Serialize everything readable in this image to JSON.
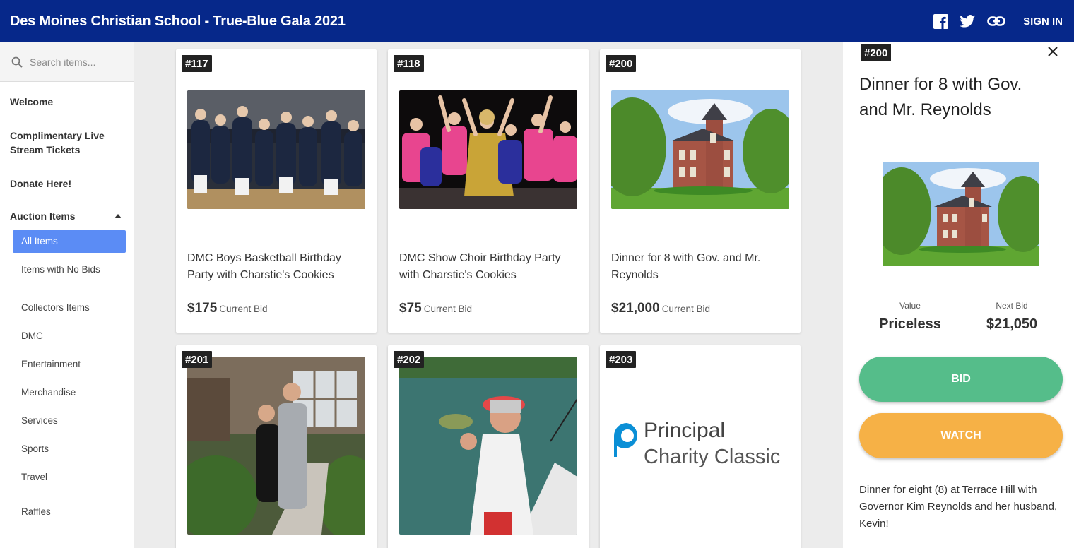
{
  "header": {
    "title": "Des Moines Christian School - True-Blue Gala 2021",
    "sign_in": "SIGN IN",
    "icons": [
      "facebook-icon",
      "twitter-icon",
      "link-icon"
    ],
    "bg_color": "#06288a"
  },
  "sidebar": {
    "search_placeholder": "Search items...",
    "welcome": "Welcome",
    "stream": "Complimentary Live Stream Tickets",
    "donate": "Donate Here!",
    "auction_section": "Auction Items",
    "all_items": "All Items",
    "no_bids": "Items with No Bids",
    "categories": [
      "Collectors Items",
      "DMC",
      "Entertainment",
      "Merchandise",
      "Services",
      "Sports",
      "Travel"
    ],
    "raffles": "Raffles",
    "accent_color": "#5b8cf5"
  },
  "items": [
    {
      "number": "#117",
      "title": "DMC Boys Basketball Birthday Party with Charstie's Cookies",
      "bid": "$175",
      "bid_label": "Current Bid"
    },
    {
      "number": "#118",
      "title": "DMC Show Choir Birthday Party with Charstie's Cookies",
      "bid": "$75",
      "bid_label": "Current Bid"
    },
    {
      "number": "#200",
      "title": "Dinner for 8 with Gov. and Mr. Reynolds",
      "bid": "$21,000",
      "bid_label": "Current Bid"
    },
    {
      "number": "#201"
    },
    {
      "number": "#202"
    },
    {
      "number": "#203",
      "logo_line1": "Principal",
      "logo_line2": "Charity Classic"
    }
  ],
  "detail": {
    "number": "#200",
    "title": "Dinner for 8 with Gov. and Mr. Reynolds",
    "value_label": "Value",
    "value": "Priceless",
    "next_bid_label": "Next Bid",
    "next_bid": "$21,050",
    "bid_button": "BID",
    "watch_button": "WATCH",
    "description": "Dinner for eight (8) at Terrace Hill with Governor Kim Reynolds and her husband, Kevin!",
    "bid_color": "#55bd8a",
    "watch_color": "#f6b146"
  }
}
